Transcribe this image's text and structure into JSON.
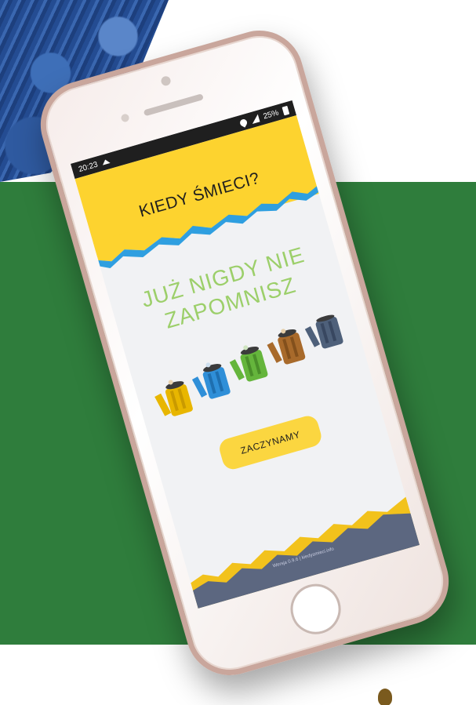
{
  "status_bar": {
    "time": "20:23",
    "battery": "25%",
    "notification_icon": "cloud-upload-icon"
  },
  "app": {
    "title": "KIEDY ŚMIECI?"
  },
  "hero": {
    "line1": "JUŻ NIGDY NIE",
    "line2": "ZAPOMNISZ"
  },
  "bins": [
    {
      "name": "yellow-bin-icon",
      "color": "#e8b600"
    },
    {
      "name": "blue-bin-icon",
      "color": "#2f8fd8"
    },
    {
      "name": "green-bin-icon",
      "color": "#65b53c"
    },
    {
      "name": "brown-bin-icon",
      "color": "#a86a2b"
    },
    {
      "name": "gray-bin-icon",
      "color": "#4e607a"
    }
  ],
  "actions": {
    "start_label": "ZACZYNAMY"
  },
  "footer": {
    "version_text": "Wersja 0.9.6 | kiedysmieci.info"
  },
  "colors": {
    "header_yellow": "#fdd32f",
    "accent_blue": "#2f9fe0",
    "accent_green": "#9ccf6a",
    "footer_slate": "#5c6780",
    "background_green": "#2f7d3c"
  }
}
